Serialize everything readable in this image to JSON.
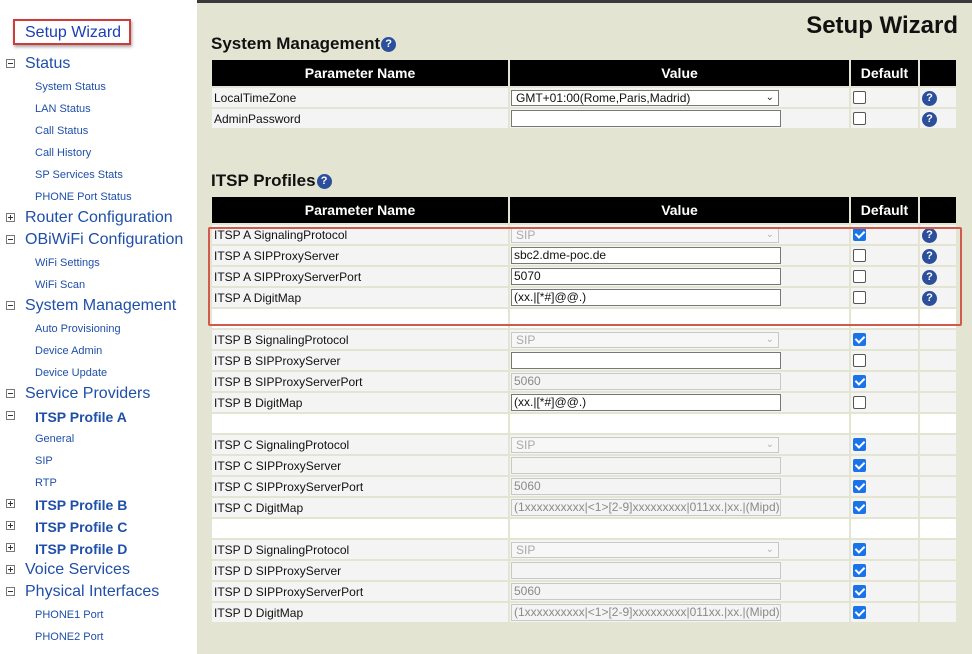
{
  "sidebar": {
    "setup_wizard": "Setup Wizard",
    "status": {
      "label": "Status",
      "items": [
        "System Status",
        "LAN Status",
        "Call Status",
        "Call History",
        "SP Services Stats",
        "PHONE Port Status"
      ]
    },
    "router_configuration": "Router Configuration",
    "obiwifi": {
      "label": "OBiWiFi Configuration",
      "items": [
        "WiFi Settings",
        "WiFi Scan"
      ]
    },
    "system_management": {
      "label": "System Management",
      "items": [
        "Auto Provisioning",
        "Device Admin",
        "Device Update"
      ]
    },
    "service_providers": {
      "label": "Service Providers",
      "itsp_a": "ITSP Profile A",
      "itsp_a_items": [
        "General",
        "SIP",
        "RTP"
      ],
      "itsp_b": "ITSP Profile B",
      "itsp_c": "ITSP Profile C",
      "itsp_d": "ITSP Profile D"
    },
    "voice_services": "Voice Services",
    "physical_interfaces": {
      "label": "Physical Interfaces",
      "items": [
        "PHONE1 Port",
        "PHONE2 Port"
      ]
    }
  },
  "main": {
    "page_title": "Setup Wizard",
    "help_glyph": "?",
    "columns": {
      "param": "Parameter Name",
      "value": "Value",
      "default": "Default"
    },
    "system_management": {
      "title": "System Management",
      "rows": [
        {
          "name": "LocalTimeZone",
          "value": "GMT+01:00(Rome,Paris,Madrid)",
          "type": "select",
          "disabled": false,
          "default": false,
          "help": true
        },
        {
          "name": "AdminPassword",
          "value": "",
          "type": "input",
          "disabled": false,
          "default": false,
          "help": true
        }
      ]
    },
    "itsp_profiles": {
      "title": "ITSP Profiles",
      "rows": [
        {
          "name": "ITSP A SignalingProtocol",
          "value": "SIP",
          "type": "select",
          "disabled": true,
          "default": true,
          "help": true
        },
        {
          "name": "ITSP A SIPProxyServer",
          "value": "sbc2.dme-poc.de",
          "type": "input",
          "disabled": false,
          "default": false,
          "help": true
        },
        {
          "name": "ITSP A SIPProxyServerPort",
          "value": "5070",
          "type": "input",
          "disabled": false,
          "default": false,
          "help": true
        },
        {
          "name": "ITSP A DigitMap",
          "value": "(xx.|[*#]@@.)",
          "type": "input",
          "disabled": false,
          "default": false,
          "help": true
        },
        {
          "sep": true
        },
        {
          "name": "ITSP B SignalingProtocol",
          "value": "SIP",
          "type": "select",
          "disabled": true,
          "default": true,
          "help": false
        },
        {
          "name": "ITSP B SIPProxyServer",
          "value": "",
          "type": "input",
          "disabled": false,
          "default": false,
          "help": false
        },
        {
          "name": "ITSP B SIPProxyServerPort",
          "value": "5060",
          "type": "input",
          "disabled": true,
          "default": true,
          "help": false
        },
        {
          "name": "ITSP B DigitMap",
          "value": "(xx.|[*#]@@.)",
          "type": "input",
          "disabled": false,
          "default": false,
          "help": false
        },
        {
          "sep": true
        },
        {
          "name": "ITSP C SignalingProtocol",
          "value": "SIP",
          "type": "select",
          "disabled": true,
          "default": true,
          "help": false
        },
        {
          "name": "ITSP C SIPProxyServer",
          "value": "",
          "type": "input",
          "disabled": true,
          "default": true,
          "help": false
        },
        {
          "name": "ITSP C SIPProxyServerPort",
          "value": "5060",
          "type": "input",
          "disabled": true,
          "default": true,
          "help": false
        },
        {
          "name": "ITSP C DigitMap",
          "value": "(1xxxxxxxxxx|<1>[2-9]xxxxxxxxx|011xx.|xx.|(Mipd)",
          "type": "input",
          "disabled": true,
          "default": true,
          "help": false
        },
        {
          "sep": true
        },
        {
          "name": "ITSP D SignalingProtocol",
          "value": "SIP",
          "type": "select",
          "disabled": true,
          "default": true,
          "help": false
        },
        {
          "name": "ITSP D SIPProxyServer",
          "value": "",
          "type": "input",
          "disabled": true,
          "default": true,
          "help": false
        },
        {
          "name": "ITSP D SIPProxyServerPort",
          "value": "5060",
          "type": "input",
          "disabled": true,
          "default": true,
          "help": false
        },
        {
          "name": "ITSP D DigitMap",
          "value": "(1xxxxxxxxxx|<1>[2-9]xxxxxxxxx|011xx.|xx.|(Mipd)",
          "type": "input",
          "disabled": true,
          "default": true,
          "help": false
        }
      ]
    }
  }
}
